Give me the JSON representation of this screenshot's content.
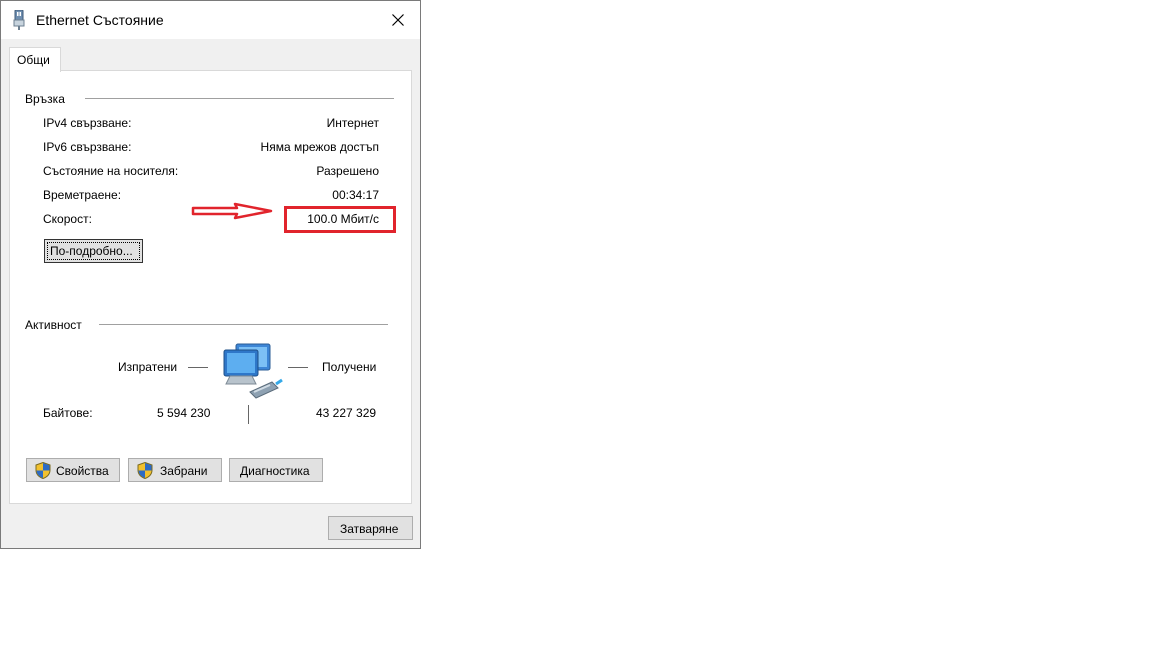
{
  "window": {
    "title": "Ethernet Състояние",
    "tab_general": "Общи"
  },
  "connection": {
    "group_label": "Връзка",
    "rows": [
      {
        "label": "IPv4 свързване:",
        "value": "Интернет"
      },
      {
        "label": "IPv6 свързване:",
        "value": "Няма мрежов достъп"
      },
      {
        "label": "Състояние на носителя:",
        "value": "Разрешено"
      },
      {
        "label": "Времетраене:",
        "value": "00:34:17"
      },
      {
        "label": "Скорост:",
        "value": "100.0 Мбит/с"
      }
    ],
    "details_button": "По-подробно..."
  },
  "activity": {
    "group_label": "Активност",
    "sent_label": "Изпратени",
    "received_label": "Получени",
    "bytes_label": "Байтове:",
    "bytes_sent": "5 594 230",
    "bytes_received": "43 227 329"
  },
  "buttons": {
    "properties": "Свойства",
    "disable": "Забрани",
    "diagnose": "Диагностика",
    "close": "Затваряне"
  },
  "colors": {
    "annotation": "#e1242c",
    "window_bg": "#f0f0f0",
    "panel_bg": "#ffffff"
  }
}
